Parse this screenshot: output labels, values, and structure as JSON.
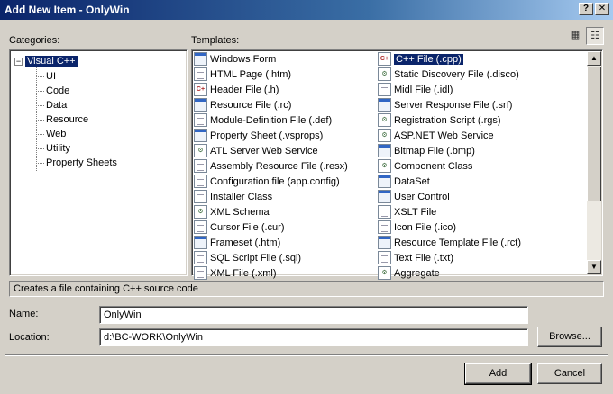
{
  "window": {
    "title": "Add New Item - OnlyWin",
    "help_glyph": "?",
    "close_glyph": "✕"
  },
  "categories": {
    "label": "Categories:",
    "root": {
      "label": "Visual C++",
      "expander": "−"
    },
    "children": [
      "UI",
      "Code",
      "Data",
      "Resource",
      "Web",
      "Utility",
      "Property Sheets"
    ]
  },
  "templates": {
    "label": "Templates:",
    "view_large_glyph": "▦",
    "view_small_glyph": "☷",
    "col1": [
      {
        "label": "Windows Form",
        "icon": "form"
      },
      {
        "label": "HTML Page (.htm)",
        "icon": "doc"
      },
      {
        "label": "Header File (.h)",
        "icon": "code"
      },
      {
        "label": "Resource File (.rc)",
        "icon": "form"
      },
      {
        "label": "Module-Definition File (.def)",
        "icon": "doc"
      },
      {
        "label": "Property Sheet (.vsprops)",
        "icon": "form"
      },
      {
        "label": "ATL Server Web Service",
        "icon": "gear"
      },
      {
        "label": "Assembly Resource File (.resx)",
        "icon": "doc"
      },
      {
        "label": "Configuration file (app.config)",
        "icon": "doc"
      },
      {
        "label": "Installer Class",
        "icon": "doc"
      },
      {
        "label": "XML Schema",
        "icon": "gear"
      },
      {
        "label": "Cursor File (.cur)",
        "icon": "doc"
      },
      {
        "label": "Frameset (.htm)",
        "icon": "form"
      },
      {
        "label": "SQL Script File (.sql)",
        "icon": "doc"
      },
      {
        "label": "XML File (.xml)",
        "icon": "doc"
      }
    ],
    "col2": [
      {
        "label": "C++ File (.cpp)",
        "icon": "code"
      },
      {
        "label": "Static Discovery File (.disco)",
        "icon": "gear"
      },
      {
        "label": "Midl File (.idl)",
        "icon": "doc"
      },
      {
        "label": "Server Response File (.srf)",
        "icon": "form"
      },
      {
        "label": "Registration Script (.rgs)",
        "icon": "gear"
      },
      {
        "label": "ASP.NET Web Service",
        "icon": "gear"
      },
      {
        "label": "Bitmap File (.bmp)",
        "icon": "form"
      },
      {
        "label": "Component Class",
        "icon": "gear"
      },
      {
        "label": "DataSet",
        "icon": "form"
      },
      {
        "label": "User Control",
        "icon": "form"
      },
      {
        "label": "XSLT File",
        "icon": "doc"
      },
      {
        "label": "Icon File (.ico)",
        "icon": "doc"
      },
      {
        "label": "Resource Template File (.rct)",
        "icon": "form"
      },
      {
        "label": "Text File (.txt)",
        "icon": "doc"
      },
      {
        "label": "Aggregate",
        "icon": "gear"
      }
    ],
    "selected": "C++ File (.cpp)",
    "scroll_up_glyph": "▲",
    "scroll_down_glyph": "▼"
  },
  "description": "Creates a file containing C++ source code",
  "name_field": {
    "label": "Name:",
    "value": "OnlyWin"
  },
  "location_field": {
    "label": "Location:",
    "value": "d:\\BC-WORK\\OnlyWin"
  },
  "buttons": {
    "browse": "Browse...",
    "add": "Add",
    "cancel": "Cancel"
  }
}
